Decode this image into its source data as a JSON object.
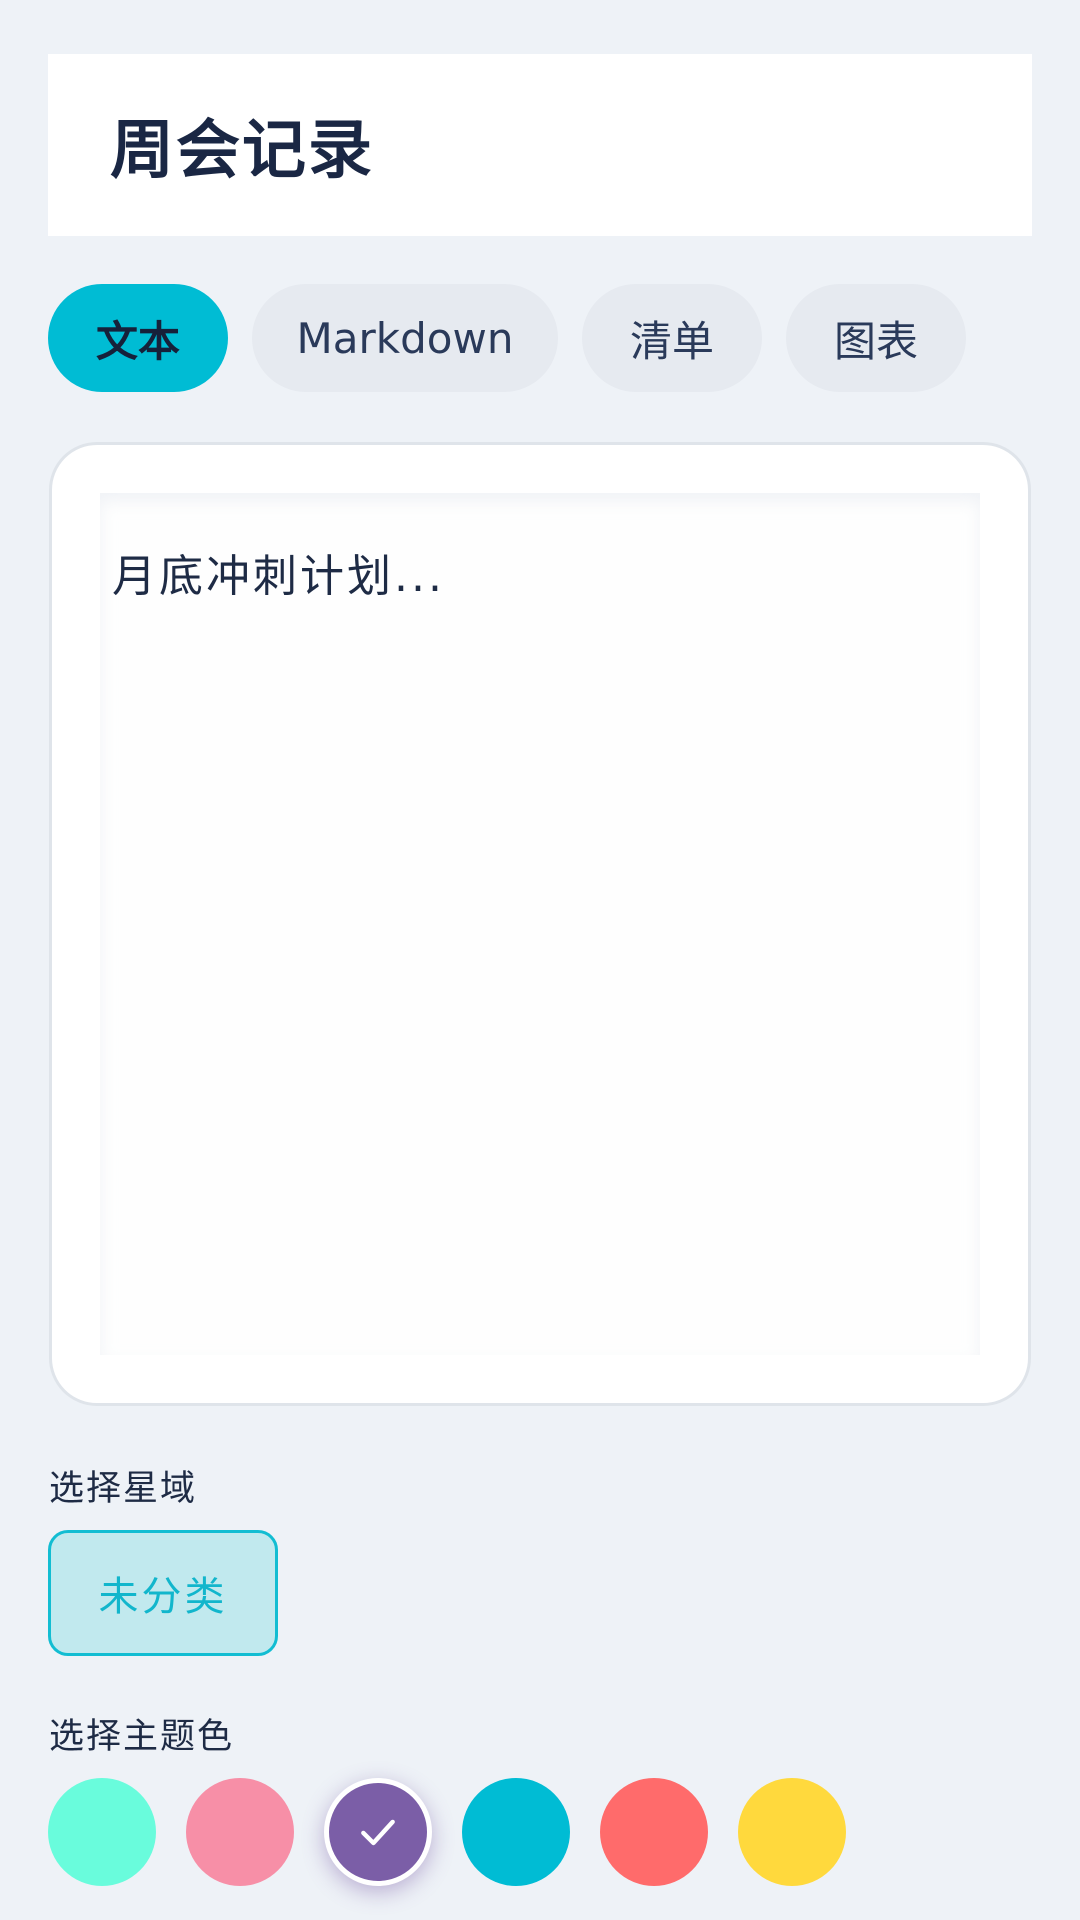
{
  "header": {
    "title": "周会记录"
  },
  "tabs": [
    {
      "label": "文本",
      "active": true
    },
    {
      "label": "Markdown",
      "active": false
    },
    {
      "label": "清单",
      "active": false
    },
    {
      "label": "图表",
      "active": false
    }
  ],
  "editor": {
    "content": "月底冲刺计划..."
  },
  "domain_section": {
    "label": "选择星域",
    "selected": "未分类"
  },
  "theme_section": {
    "label": "选择主题色",
    "colors": [
      "#69fcdc",
      "#f78fa7",
      "#7b5ea7",
      "#00bcd4",
      "#ff6b6b",
      "#ffd93d"
    ],
    "selected_index": 2,
    "selected_icon": "check-icon"
  }
}
